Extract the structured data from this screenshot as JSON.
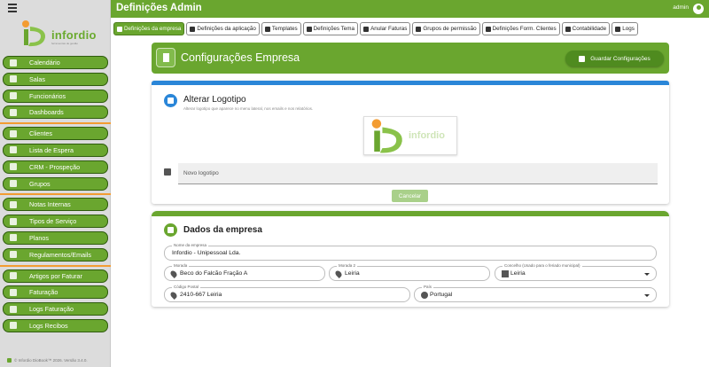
{
  "header": {
    "title": "Definições Admin",
    "user": "admin"
  },
  "brand": {
    "name": "infordio",
    "tagline": "ferramentas de gestão"
  },
  "sidebar": {
    "groups": [
      [
        {
          "label": "Calendário",
          "icon": "calendar-icon"
        },
        {
          "label": "Salas",
          "icon": "room-icon"
        },
        {
          "label": "Funcionários",
          "icon": "employees-icon"
        },
        {
          "label": "Dashboards",
          "icon": "dashboard-icon"
        }
      ],
      [
        {
          "label": "Clientes",
          "icon": "clients-icon"
        },
        {
          "label": "Lista de Espera",
          "icon": "waitlist-icon"
        },
        {
          "label": "CRM - Prospeção",
          "icon": "crm-icon"
        },
        {
          "label": "Grupos",
          "icon": "groups-icon"
        }
      ],
      [
        {
          "label": "Notas Internas",
          "icon": "notes-icon"
        },
        {
          "label": "Tipos de Serviço",
          "icon": "service-types-icon"
        },
        {
          "label": "Planos",
          "icon": "plans-icon"
        },
        {
          "label": "Regulamentos/Emails",
          "icon": "regulations-icon"
        }
      ],
      [
        {
          "label": "Artigos por Faturar",
          "icon": "articles-icon"
        },
        {
          "label": "Faturação",
          "icon": "billing-icon"
        },
        {
          "label": "Logs Faturação",
          "icon": "billing-logs-icon"
        },
        {
          "label": "Logs Recibos",
          "icon": "receipt-logs-icon"
        }
      ]
    ],
    "copyright": "© Infordio DioBook™ 2026. Versão 3.4.0."
  },
  "tabs": [
    {
      "label": "Definições da empresa",
      "active": true
    },
    {
      "label": "Definições da aplicação",
      "active": false
    },
    {
      "label": "Templates",
      "active": false
    },
    {
      "label": "Definições Tema",
      "active": false
    },
    {
      "label": "Anular Faturas",
      "active": false
    },
    {
      "label": "Grupos de permissão",
      "active": false
    },
    {
      "label": "Definições Form. Clientes",
      "active": false
    },
    {
      "label": "Contabilidade",
      "active": false
    },
    {
      "label": "Logs",
      "active": false
    }
  ],
  "config": {
    "title": "Configurações Empresa",
    "save_label": "Guardar Configurações"
  },
  "logo_section": {
    "title": "Alterar Logotipo",
    "subtitle": "Alterar logotipo que aparece no menu lateral, nos emails e nos relatórios.",
    "logo_text": "infordio",
    "file_placeholder": "Novo logotipo",
    "cancel_label": "Cancelar"
  },
  "company": {
    "title": "Dados da empresa",
    "name_label": "Nome da empresa",
    "name_value": "Infordio - Unipessoal Lda.",
    "address_label": "Morada",
    "address_value": "Beco do Falcão Fração A",
    "address2_label": "Morada 2",
    "address2_value": "Leiria",
    "county_label": "Concelho (Usado para o feriado municipal)",
    "county_value": "Leiria",
    "postal_label": "Código Postal",
    "postal_value": "2410-667 Leiria",
    "country_label": "País",
    "country_value": "Portugal"
  },
  "colors": {
    "primary": "#6aa62f",
    "accent": "#2a86d8",
    "separator": "#f39c32"
  }
}
